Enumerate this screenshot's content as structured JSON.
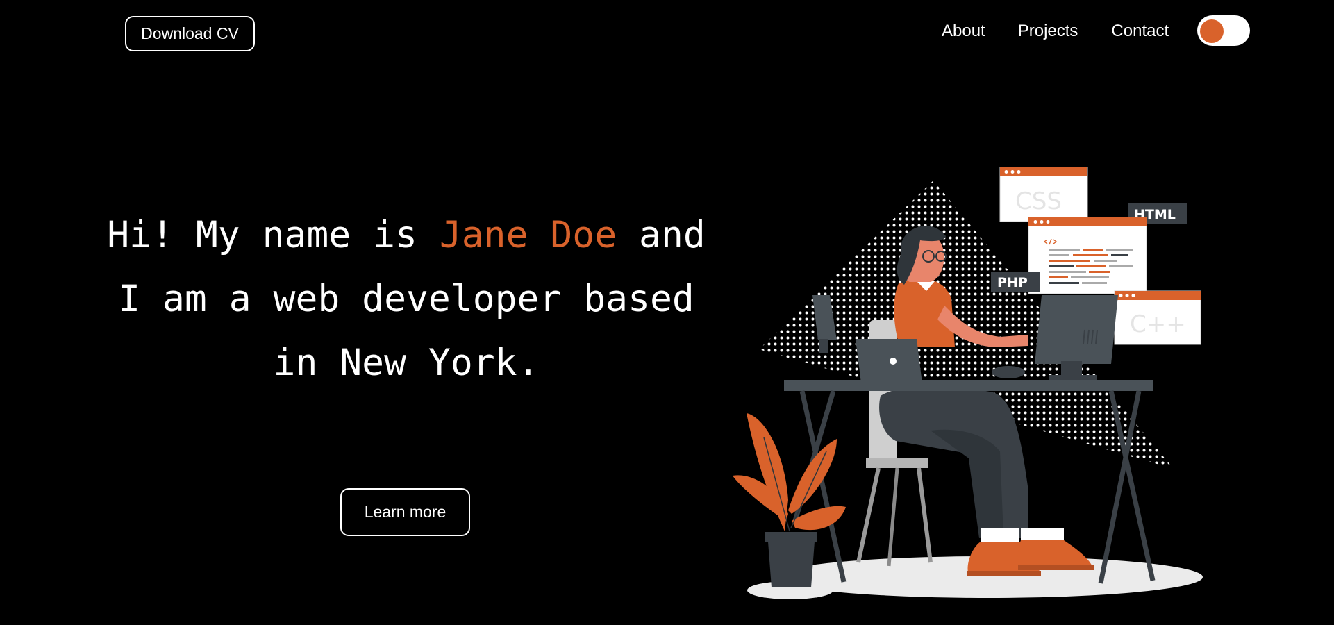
{
  "nav": {
    "download_cv": "Download CV",
    "links": [
      "About",
      "Projects",
      "Contact"
    ],
    "theme_toggle_icon": "toggle-switch-icon"
  },
  "hero": {
    "greeting": "Hi! My name is ",
    "name": "Jane Doe",
    "description": "and I am a web developer based in New York.",
    "cta": "Learn more"
  },
  "illustration": {
    "labels": {
      "css": "CSS",
      "html": "HTML",
      "php": "PHP",
      "cpp": "C++"
    }
  },
  "colors": {
    "background": "#000000",
    "text": "#ffffff",
    "accent": "#d9622b",
    "dark_gray": "#3a4046"
  }
}
